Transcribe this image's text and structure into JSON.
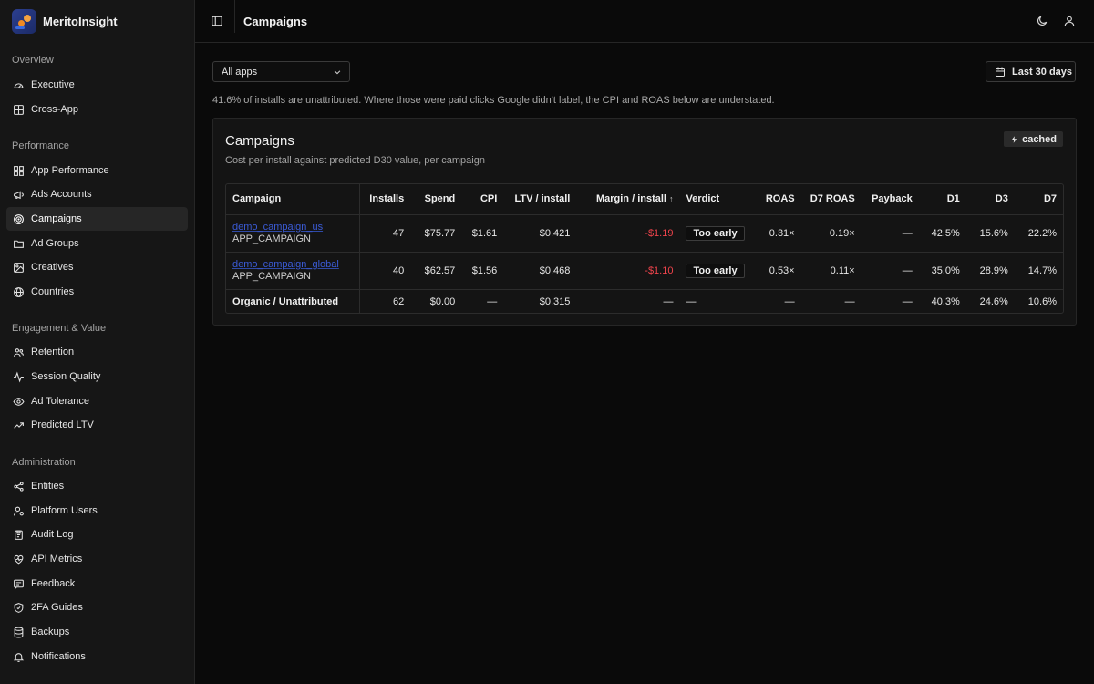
{
  "brand": {
    "name": "MeritoInsight"
  },
  "sidebar": {
    "sections": [
      {
        "label": "Overview"
      },
      {
        "label": "Performance"
      },
      {
        "label": "Engagement & Value"
      },
      {
        "label": "Administration"
      }
    ],
    "items": [
      {
        "label": "Executive",
        "icon": "gauge-icon"
      },
      {
        "label": "Cross-App",
        "icon": "grid-icon"
      },
      {
        "label": "App Performance",
        "icon": "apps-grid-icon"
      },
      {
        "label": "Ads Accounts",
        "icon": "megaphone-icon"
      },
      {
        "label": "Campaigns",
        "icon": "target-icon",
        "active": true
      },
      {
        "label": "Ad Groups",
        "icon": "folder-icon"
      },
      {
        "label": "Creatives",
        "icon": "image-icon"
      },
      {
        "label": "Countries",
        "icon": "globe-icon"
      },
      {
        "label": "Retention",
        "icon": "users-icon"
      },
      {
        "label": "Session Quality",
        "icon": "activity-icon"
      },
      {
        "label": "Ad Tolerance",
        "icon": "eye-icon"
      },
      {
        "label": "Predicted LTV",
        "icon": "trending-up-icon"
      },
      {
        "label": "Entities",
        "icon": "share-icon"
      },
      {
        "label": "Platform Users",
        "icon": "user-cog-icon"
      },
      {
        "label": "Audit Log",
        "icon": "clipboard-icon"
      },
      {
        "label": "API Metrics",
        "icon": "heart-pulse-icon"
      },
      {
        "label": "Feedback",
        "icon": "message-icon"
      },
      {
        "label": "2FA Guides",
        "icon": "shield-icon"
      },
      {
        "label": "Backups",
        "icon": "database-icon"
      },
      {
        "label": "Notifications",
        "icon": "bell-icon"
      }
    ]
  },
  "header": {
    "title": "Campaigns"
  },
  "filters": {
    "app_select": "All apps",
    "date_range": "Last 30 days"
  },
  "notice": "41.6% of installs are unattributed. Where those were paid clicks Google didn't label, the CPI and ROAS below are understated.",
  "card": {
    "title": "Campaigns",
    "subtitle": "Cost per install against predicted D30 value, per campaign",
    "badge": "cached"
  },
  "table": {
    "columns": [
      "Campaign",
      "Installs",
      "Spend",
      "CPI",
      "LTV / install",
      "Margin / install",
      "Verdict",
      "ROAS",
      "D7 ROAS",
      "Payback",
      "D1",
      "D3",
      "D7"
    ],
    "sort_indicator": "↑",
    "rows": [
      {
        "name": "demo_campaign_us",
        "type": "APP_CAMPAIGN",
        "installs": "47",
        "spend": "$75.77",
        "cpi": "$1.61",
        "ltv": "$0.421",
        "margin": "-$1.19",
        "verdict": "Too early",
        "roas": "0.31×",
        "d7roas": "0.19×",
        "payback": "—",
        "d1": "42.5%",
        "d3": "15.6%",
        "d7": "22.2%"
      },
      {
        "name": "demo_campaign_global",
        "type": "APP_CAMPAIGN",
        "installs": "40",
        "spend": "$62.57",
        "cpi": "$1.56",
        "ltv": "$0.468",
        "margin": "-$1.10",
        "verdict": "Too early",
        "roas": "0.53×",
        "d7roas": "0.11×",
        "payback": "—",
        "d1": "35.0%",
        "d3": "28.9%",
        "d7": "14.7%"
      },
      {
        "name": "Organic / Unattributed",
        "installs": "62",
        "spend": "$0.00",
        "cpi": "—",
        "ltv": "$0.315",
        "margin": "—",
        "verdict": "—",
        "roas": "—",
        "d7roas": "—",
        "payback": "—",
        "d1": "40.3%",
        "d3": "24.6%",
        "d7": "10.6%"
      }
    ]
  }
}
